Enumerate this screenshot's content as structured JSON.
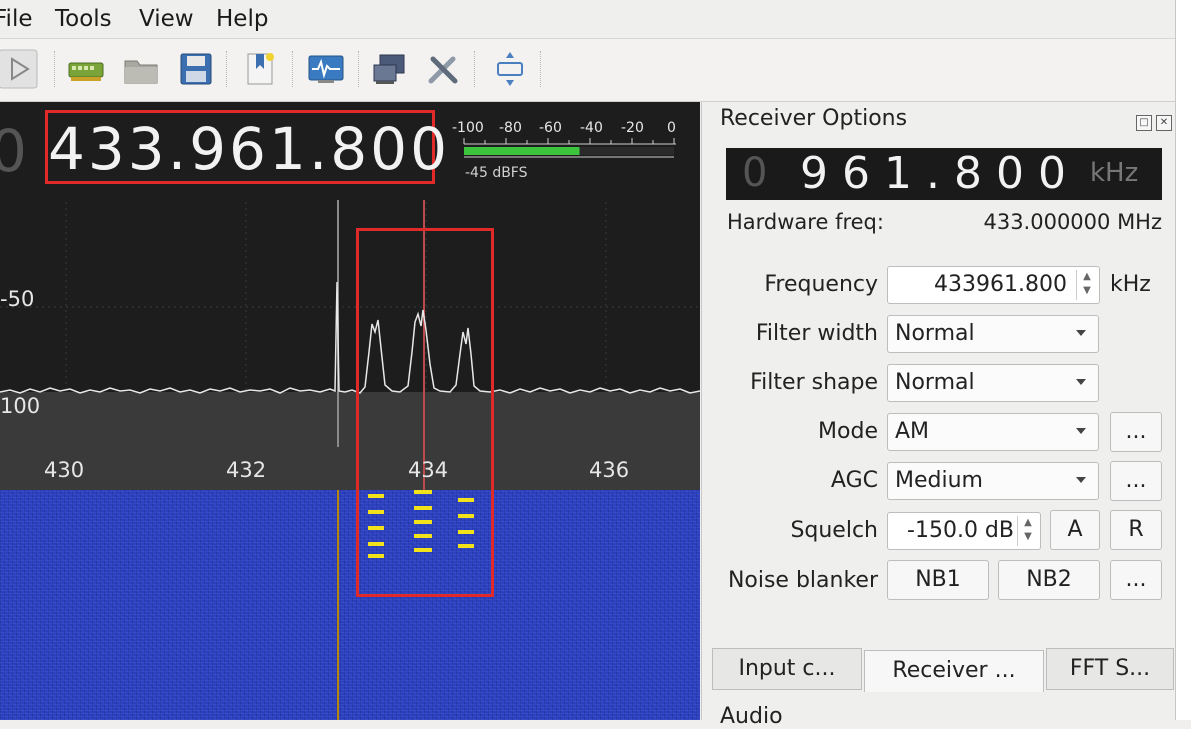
{
  "menu": {
    "items": [
      "File",
      "Tools",
      "View",
      "Help"
    ]
  },
  "toolbar": {
    "buttons": [
      "play-icon",
      "sdr-device-icon",
      "open-folder-icon",
      "save-icon",
      "bookmark-icon",
      "signal-analyzer-icon",
      "remote-control-icon",
      "tools-icon",
      "dock-move-icon"
    ]
  },
  "display": {
    "frequency": "433.961.800",
    "frequency_ghost": "0",
    "meter": {
      "scale": [
        "-100",
        "-80",
        "-60",
        "-40",
        "-20",
        "0"
      ],
      "level_label": "-45 dBFS",
      "level_dbfs": -45
    },
    "y_labels": [
      "-50",
      "100"
    ],
    "x_labels": [
      "430",
      "432",
      "434",
      "436"
    ],
    "colors": {
      "spectrum_bg": "#1d1d1d",
      "waterfall": "#2a3fbd",
      "highlight": "#e02a2a",
      "marker": "#b8860b",
      "meter_fill": "#3cc43c"
    }
  },
  "receiver": {
    "title": "Receiver Options",
    "lcd": {
      "ghost": "0",
      "digits": "961.800",
      "unit": "kHz"
    },
    "hardware_freq_label": "Hardware freq:",
    "hardware_freq_value": "433.000000 MHz",
    "frequency": {
      "label": "Frequency",
      "value": "433961.800",
      "unit": "kHz"
    },
    "filter_width": {
      "label": "Filter width",
      "value": "Normal"
    },
    "filter_shape": {
      "label": "Filter shape",
      "value": "Normal"
    },
    "mode": {
      "label": "Mode",
      "value": "AM",
      "more": "..."
    },
    "agc": {
      "label": "AGC",
      "value": "Medium",
      "more": "..."
    },
    "squelch": {
      "label": "Squelch",
      "value": "-150.0 dB",
      "btn_a": "A",
      "btn_r": "R"
    },
    "noise_blanker": {
      "label": "Noise blanker",
      "nb1": "NB1",
      "nb2": "NB2",
      "more": "..."
    }
  },
  "tabs": {
    "input": "Input c...",
    "receiver": "Receiver ...",
    "fft": "FFT S..."
  },
  "audio": {
    "label": "Audio"
  }
}
